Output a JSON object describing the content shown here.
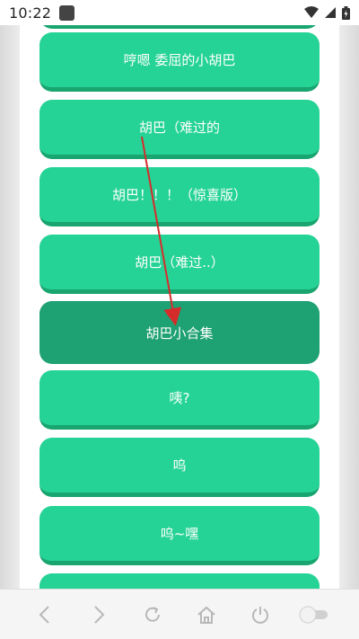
{
  "status_bar": {
    "time": "10:22"
  },
  "buttons": [
    {
      "label": "哼嗯 委屈的小胡巴",
      "active": false
    },
    {
      "label": "胡巴（难过的",
      "active": false
    },
    {
      "label": "胡巴！！！（惊喜版）",
      "active": false
    },
    {
      "label": "胡巴（难过..）",
      "active": false
    },
    {
      "label": "胡巴小合集",
      "active": true
    },
    {
      "label": "咦?",
      "active": false
    },
    {
      "label": "呜",
      "active": false
    },
    {
      "label": "呜~嘿",
      "active": false
    }
  ],
  "colors": {
    "button_green": "#26d396",
    "button_active": "#1ea173",
    "arrow_red": "#d62b2b"
  },
  "bottom_nav_icons": [
    "back-icon",
    "forward-icon",
    "refresh-icon",
    "home-icon",
    "power-icon",
    "toggle-switch"
  ]
}
